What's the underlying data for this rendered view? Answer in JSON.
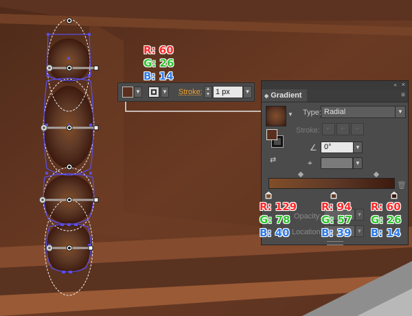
{
  "colors": {
    "bg_dark": "#4d2a1a",
    "bg_mid": "#6b3b24",
    "bg_light": "#8a4f30",
    "bead_center": "#814e28",
    "bead_mid": "#5e3920",
    "bead_edge": "#3c1a0e",
    "selection": "#5a4ee6",
    "red_text": "#ff2a2a",
    "green_text": "#2ec42e",
    "blue_text": "#2e7ce8",
    "orange_label": "#f0a030",
    "panel_bg": "#4b4b4b"
  },
  "top_rgb": {
    "r_label": "R:",
    "r": "60",
    "g_label": "G:",
    "g": "26",
    "b_label": "B:",
    "b": "14"
  },
  "control_bar": {
    "stroke_label": "Stroke:",
    "stroke_value": "1 px",
    "fill_swatch_color": "#5a2f1e",
    "dropdown_icon": "chevron-down-icon"
  },
  "gradient_panel": {
    "tab_label": "Gradient",
    "collapse_icon": "«",
    "close_icon": "×",
    "menu_icon": "≡",
    "type_label": "Type:",
    "type_value": "Radial",
    "stroke_label": "Stroke:",
    "angle_value": "0°",
    "opacity_label": "Opacity:",
    "location_label": "Location:",
    "stops": [
      {
        "r": "129",
        "g": "78",
        "b": "40",
        "color": "#814e28",
        "location": 0
      },
      {
        "r": "94",
        "g": "57",
        "b": "39",
        "color": "#5e3927",
        "location": 0.52
      },
      {
        "r": "60",
        "g": "26",
        "b": "14",
        "color": "#3c1a0e",
        "location": 1.0
      }
    ]
  },
  "stop_rgb_labels": {
    "r_label": "R:",
    "g_label": "G:",
    "b_label": "B:"
  }
}
